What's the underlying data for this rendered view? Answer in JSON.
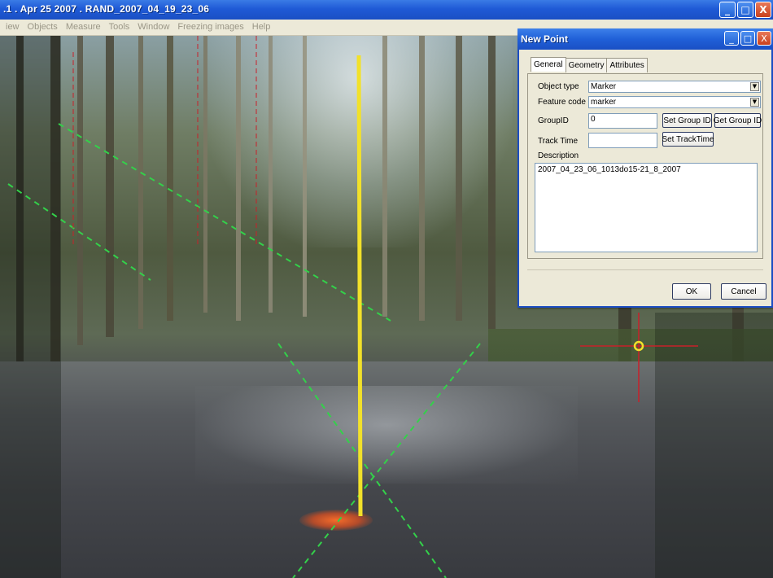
{
  "window": {
    "title": ".1 . Apr 25 2007 . RAND_2007_04_19_23_06",
    "buttons": {
      "minimize": "_",
      "maximize": "□",
      "close": "X"
    }
  },
  "menu": {
    "items": [
      "iew",
      "Objects",
      "Measure",
      "Tools",
      "Window",
      "Freezing images",
      "Help"
    ]
  },
  "dialog": {
    "title": "New Point",
    "tabs": [
      "General",
      "Geometry",
      "Attributes"
    ],
    "object_type": {
      "label": "Object type",
      "value": "Marker"
    },
    "feature_code": {
      "label": "Feature code",
      "value": "marker"
    },
    "group_id": {
      "label": "GroupID",
      "value": "0"
    },
    "track_time": {
      "label": "Track Time",
      "value": ""
    },
    "buttons": {
      "set_group_id": "Set Group ID",
      "get_group_id": "Get Group ID",
      "set_track_time": "Set TrackTime",
      "ok": "OK",
      "cancel": "Cancel"
    },
    "description": {
      "label": "Description",
      "value": "2007_04_23_06_1013do15-21_8_2007"
    }
  },
  "colors": {
    "titlebar": "#1f5ad6",
    "measure_line": "#f2e12a",
    "guide_lines": "#33d14a",
    "crosshair": "#c8202a",
    "marker_ring": "#f2e12a"
  }
}
